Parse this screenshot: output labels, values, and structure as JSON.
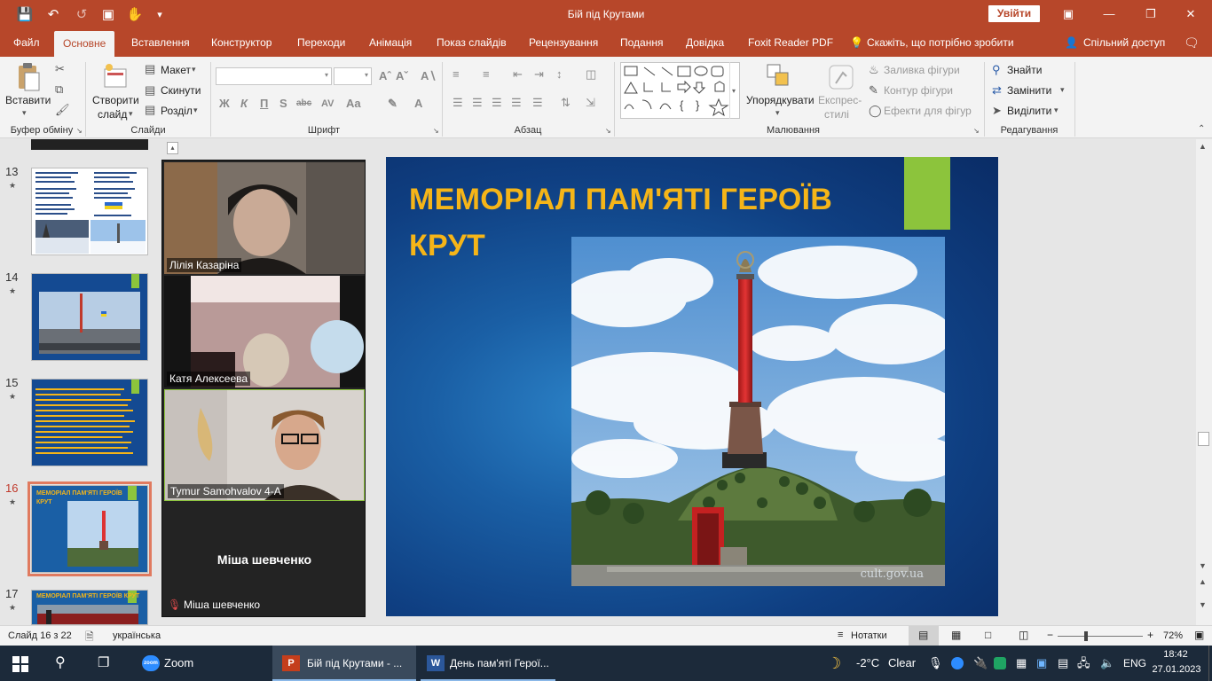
{
  "window": {
    "title": "Бій під Крутами",
    "signin": "Увійти"
  },
  "tabs": [
    "Файл",
    "Основне",
    "Вставлення",
    "Конструктор",
    "Переходи",
    "Анімація",
    "Показ слайдів",
    "Рецензування",
    "Подання",
    "Довідка",
    "Foxit Reader PDF"
  ],
  "tell_me": "Скажіть, що потрібно зробити",
  "share": "Спільний доступ",
  "ribbon": {
    "paste": "Вставити",
    "new_slide_1": "Створити",
    "new_slide_2": "слайд",
    "layout": "Макет",
    "reset": "Скинути",
    "section": "Розділ",
    "arrange": "Упорядкувати",
    "quick_styles_1": "Експрес-",
    "quick_styles_2": "стилі",
    "shape_fill": "Заливка фігури",
    "shape_outline": "Контур фігури",
    "shape_effects": "Ефекти для фігур",
    "find": "Знайти",
    "replace": "Замінити",
    "select": "Виділити",
    "groups": {
      "clipboard": "Буфер обміну",
      "slides": "Слайди",
      "font": "Шрифт",
      "paragraph": "Абзац",
      "drawing": "Малювання",
      "editing": "Редагування"
    }
  },
  "thumbnails": [
    {
      "num": "13",
      "star": "★"
    },
    {
      "num": "14",
      "star": "★"
    },
    {
      "num": "15",
      "star": "★"
    },
    {
      "num": "16",
      "star": "★",
      "title": "МЕМОРІАЛ ПАМ'ЯТІ ГЕРОЇВ КРУТ"
    },
    {
      "num": "17",
      "star": "★",
      "title": "МЕМОРІАЛ ПАМ'ЯТІ ГЕРОЇВ КРУТ"
    }
  ],
  "zoom": {
    "participants": [
      "Лілія Казаріна",
      "Катя Алексеева",
      "Tymur Samohvalov 4-А"
    ],
    "no_video_name": "Міша шевченко",
    "muted_label": "Міша шевченко"
  },
  "slide": {
    "title": "МЕМОРІАЛ ПАМ'ЯТІ ГЕРОЇВ КРУТ",
    "watermark": "cult.gov.ua"
  },
  "status": {
    "slide_counter": "Слайд 16 з 22",
    "language": "українська",
    "notes": "Нотатки",
    "zoom": "72%"
  },
  "taskbar": {
    "apps": [
      {
        "icon": "zoom",
        "label": "Zoom"
      },
      {
        "icon": "powerpoint",
        "label": "Бій під Крутами - ..."
      },
      {
        "icon": "word",
        "label": "День пам'яті Герої..."
      }
    ],
    "weather_temp": "-2°C",
    "weather_text": "Clear",
    "lang": "ENG",
    "time": "18:42",
    "date": "27.01.2023"
  },
  "colors": {
    "accent": "#b7472a",
    "slide_title": "#f5b518",
    "slide_bg": "#1a5fa5",
    "green_bar": "#8cc43c"
  }
}
